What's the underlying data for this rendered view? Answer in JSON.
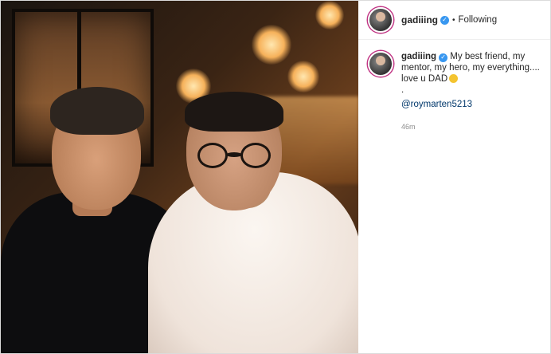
{
  "post": {
    "username": "gadiiing",
    "separator": "•",
    "follow_status": "Following",
    "menu_icon": "more-dots-icon"
  },
  "caption": {
    "username": "gadiiing",
    "text": "My best friend, my mentor, my hero, my everything.... love u DAD",
    "dot_line": ".",
    "mention": "@roymarten5213",
    "timestamp": "46m"
  },
  "colors": {
    "verified": "#3897f0",
    "story_ring": "#c13584",
    "link": "#00376b",
    "muted": "#8e8e8e"
  }
}
